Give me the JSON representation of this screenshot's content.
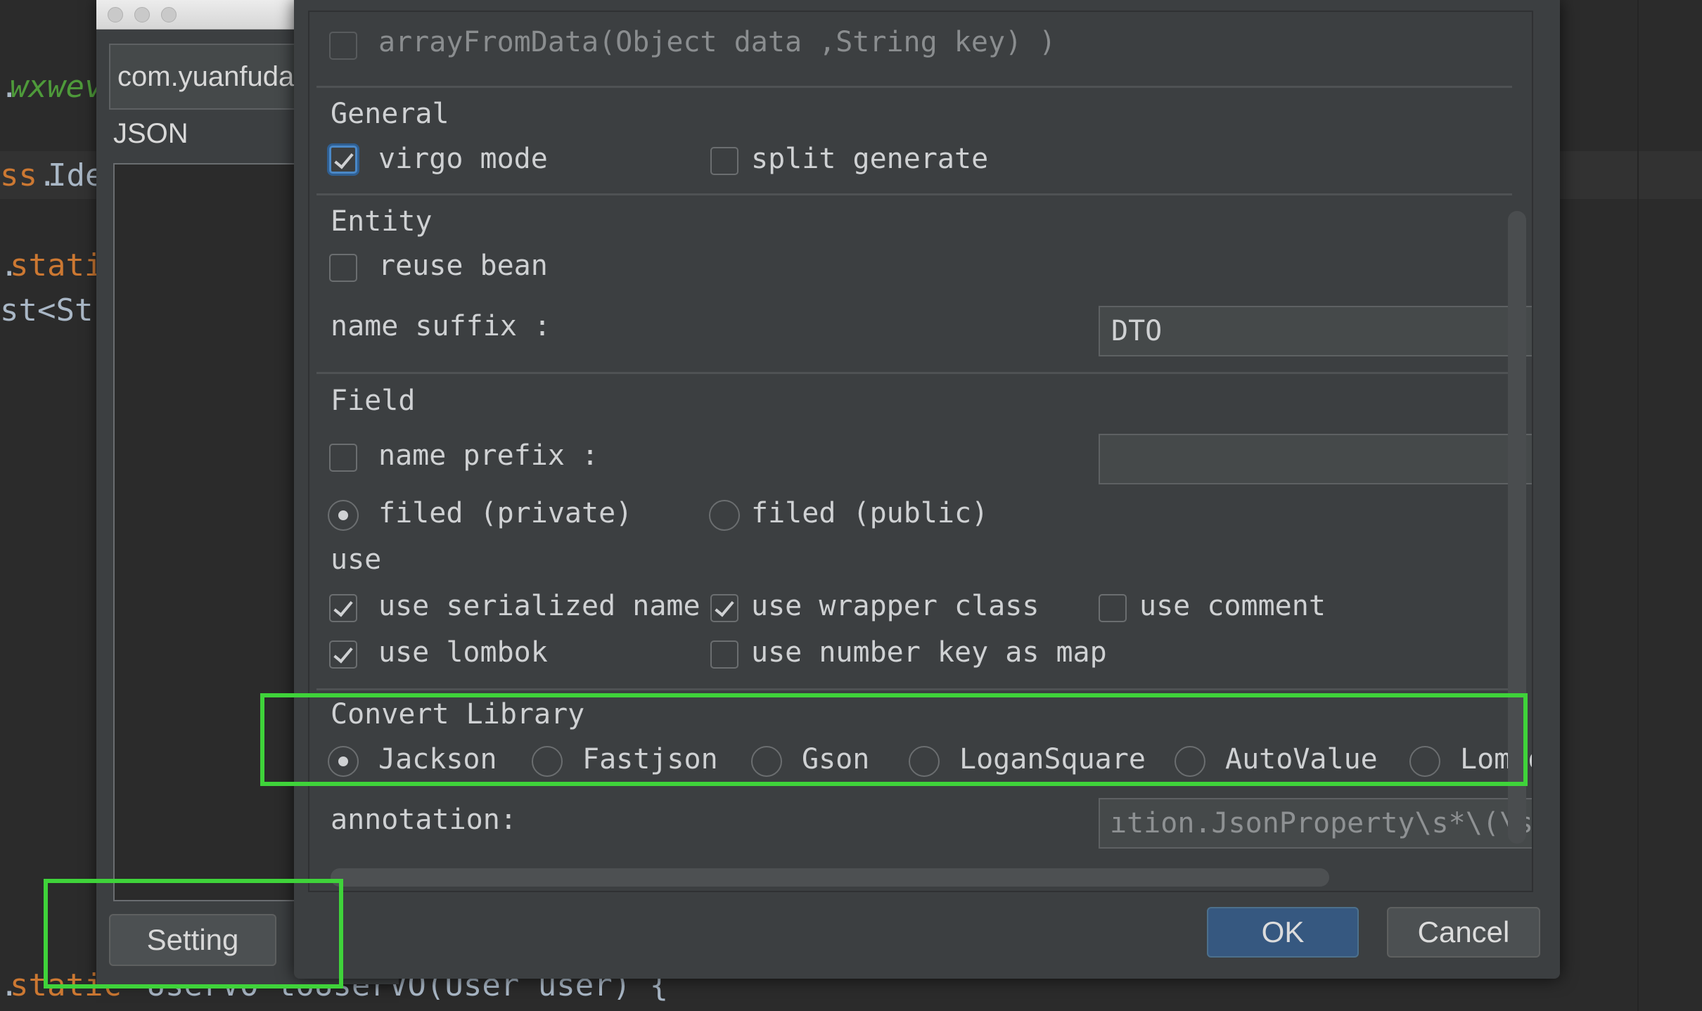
{
  "editor": {
    "code_fragments": [
      {
        "text": ".",
        "color": "#a9b7c6"
      },
      {
        "text": "wxwev",
        "color": "#4e9a3a"
      },
      {
        "text": "ss",
        "color": "#cc7832"
      },
      {
        "text": ".",
        "color": "#a9b7c6"
      },
      {
        "text": "Ide",
        "color": "#a9b7c6"
      },
      {
        "text": ".",
        "color": "#a9b7c6"
      },
      {
        "text": "stati",
        "color": "#cc7832"
      },
      {
        "text": "st<Str",
        "color": "#a9b7c6"
      },
      {
        "text": ".",
        "color": "#a9b7c6"
      },
      {
        "text": "static",
        "color": "#cc7832"
      },
      {
        "text": " UserVO toUserVO(User user) {",
        "color": "#a9b7c6"
      }
    ]
  },
  "back_dialog": {
    "package_value": "com.yuanfuda",
    "json_label": "JSON",
    "setting_button": "Setting"
  },
  "settings": {
    "array_from_data": {
      "label": "arrayFromData(Object data ,String key) )",
      "checked": false,
      "enabled": false
    },
    "general": {
      "title": "General",
      "virgo_mode": {
        "label": "virgo mode",
        "checked": true
      },
      "split_generate": {
        "label": "split generate",
        "checked": false
      }
    },
    "entity": {
      "title": "Entity",
      "reuse_bean": {
        "label": "reuse bean",
        "checked": false
      },
      "name_suffix_label": "name suffix :",
      "name_suffix_value": "DTO"
    },
    "field": {
      "title": "Field",
      "name_prefix": {
        "label": "name prefix :",
        "checked": false
      },
      "name_prefix_value": "",
      "filed_private": {
        "label": "filed (private)",
        "selected": true
      },
      "filed_public": {
        "label": "filed (public)",
        "selected": false
      }
    },
    "use": {
      "title": "use",
      "use_serialized_name": {
        "label": "use serialized name",
        "checked": true
      },
      "use_wrapper_class": {
        "label": "use wrapper class",
        "checked": true
      },
      "use_comment": {
        "label": "use comment",
        "checked": false
      },
      "use_lombok": {
        "label": "use lombok",
        "checked": true
      },
      "use_number_key_as_map": {
        "label": "use number key as map",
        "checked": false
      }
    },
    "convert_library": {
      "title": "Convert Library",
      "options": [
        "Jackson",
        "Fastjson",
        "Gson",
        "LoganSquare",
        "AutoValue",
        "Lombo"
      ],
      "selected": "Jackson"
    },
    "annotation": {
      "label": "annotation:",
      "value": "ıtion.JsonProperty\\s*\\(\\s*\"+"
    },
    "buttons": {
      "ok": "OK",
      "cancel": "Cancel"
    }
  },
  "colors": {
    "highlight": "#3fd33a",
    "primary_button": "#365880",
    "dialog_bg": "#3c3f41",
    "editor_bg": "#2b2b2b"
  }
}
